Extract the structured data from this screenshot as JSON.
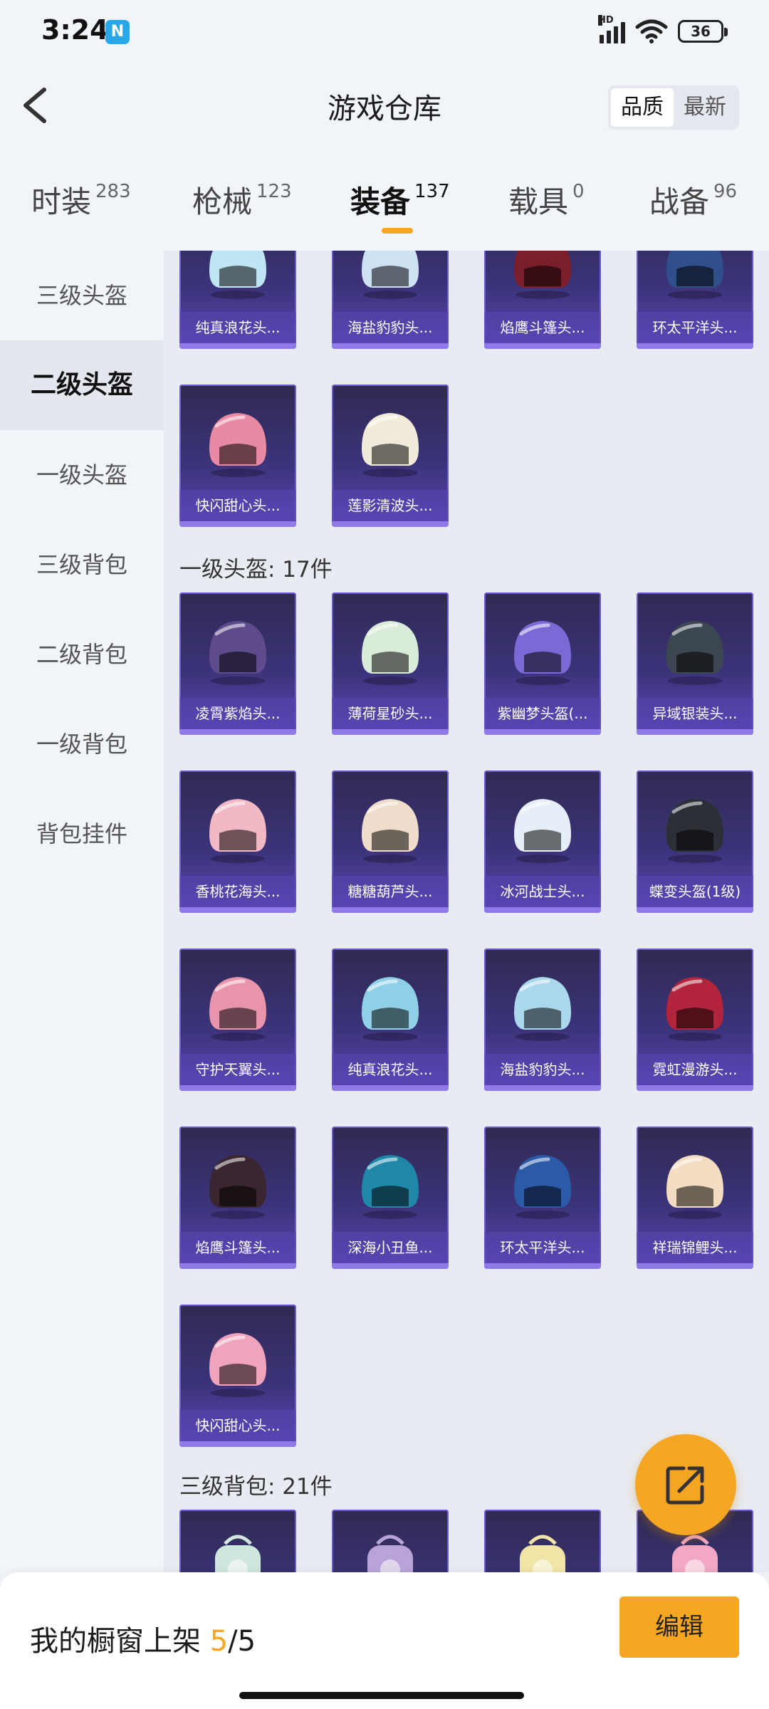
{
  "status_bar": {
    "time": "3:24",
    "nfc_icon": "N",
    "network_label": "HD",
    "battery": "36"
  },
  "header": {
    "title": "游戏仓库",
    "sort_options": [
      "品质",
      "最新"
    ],
    "active_sort": "品质"
  },
  "tabs": [
    {
      "label": "时装",
      "count": "283"
    },
    {
      "label": "枪械",
      "count": "123"
    },
    {
      "label": "装备",
      "count": "137"
    },
    {
      "label": "载具",
      "count": "0"
    },
    {
      "label": "战备",
      "count": "96"
    }
  ],
  "active_tab": "装备",
  "sidebar": {
    "items": [
      "三级头盔",
      "二级头盔",
      "一级头盔",
      "三级背包",
      "二级背包",
      "一级背包",
      "背包挂件"
    ],
    "active": "二级头盔"
  },
  "sections": {
    "level2_helmets": {
      "items": [
        {
          "name": "纯真浪花头...",
          "color": "#bfe6f2"
        },
        {
          "name": "海盐豹豹头...",
          "color": "#cfe2f3"
        },
        {
          "name": "焰鹰斗篷头...",
          "color": "#7a1e2a"
        },
        {
          "name": "环太平洋头...",
          "color": "#2f4e8a"
        },
        {
          "name": "快闪甜心头...",
          "color": "#e88aa3"
        },
        {
          "name": "莲影清波头...",
          "color": "#f1ecd9"
        }
      ]
    },
    "level1_helmets": {
      "title": "一级头盔: 17件",
      "items": [
        {
          "name": "凌霄紫焰头...",
          "color": "#5e4b8c"
        },
        {
          "name": "薄荷星砂头...",
          "color": "#d9ecd9"
        },
        {
          "name": "紫幽梦头盔(...",
          "color": "#7b6ad6"
        },
        {
          "name": "异域银装头...",
          "color": "#3c4752"
        },
        {
          "name": "香桃花海头...",
          "color": "#f2b8c4"
        },
        {
          "name": "糖糖葫芦头...",
          "color": "#f0dccb"
        },
        {
          "name": "冰河战士头...",
          "color": "#e6eef8"
        },
        {
          "name": "蝶变头盔(1级)",
          "color": "#2d2f36"
        },
        {
          "name": "守护天翼头...",
          "color": "#e895ac"
        },
        {
          "name": "纯真浪花头...",
          "color": "#8fd0e6"
        },
        {
          "name": "海盐豹豹头...",
          "color": "#a9d8ec"
        },
        {
          "name": "霓虹漫游头...",
          "color": "#b2243b"
        },
        {
          "name": "焰鹰斗篷头...",
          "color": "#3a2630"
        },
        {
          "name": "深海小丑鱼...",
          "color": "#1f87a8"
        },
        {
          "name": "环太平洋头...",
          "color": "#2b5aa8"
        },
        {
          "name": "祥瑞锦鲤头...",
          "color": "#f3dcc2"
        },
        {
          "name": "快闪甜心头...",
          "color": "#f0a4bb"
        }
      ]
    },
    "level3_backpacks": {
      "title": "三级背包: 21件",
      "items": [
        {
          "name": "",
          "color": "#cfe6dc"
        },
        {
          "name": "",
          "color": "#b9a4d8"
        },
        {
          "name": "",
          "color": "#f0e4a6"
        },
        {
          "name": "",
          "color": "#f2a8c4"
        }
      ]
    }
  },
  "showcase": {
    "label": "我的橱窗上架 ",
    "count": "5",
    "total": "/5"
  },
  "edit_button": "编辑",
  "accent_color": "#f5a623"
}
